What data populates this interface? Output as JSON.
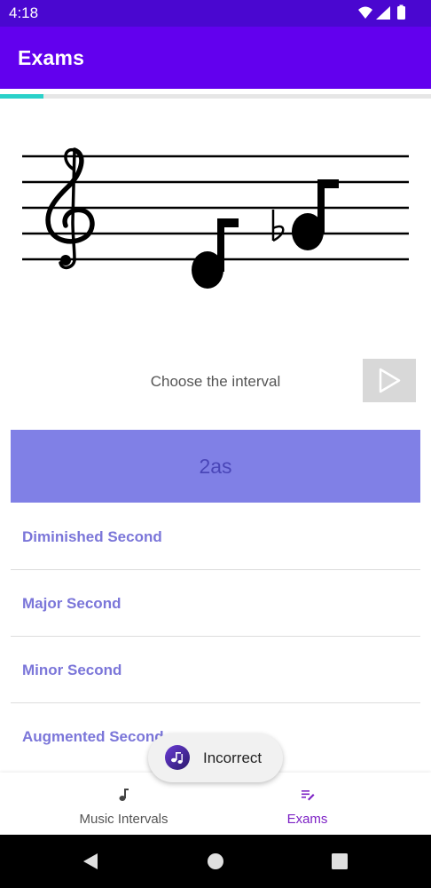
{
  "status_bar": {
    "time": "4:18"
  },
  "app_bar": {
    "title": "Exams"
  },
  "progress": {
    "fraction": 0.1
  },
  "staff": {
    "clef": "treble-clef",
    "accidental": "flat"
  },
  "prompt": {
    "text": "Choose the interval"
  },
  "answer": {
    "text": "2as"
  },
  "options": [
    {
      "label": "Diminished Second"
    },
    {
      "label": "Major Second"
    },
    {
      "label": "Minor Second"
    },
    {
      "label": "Augmented Second"
    }
  ],
  "bottom_nav": {
    "items": [
      {
        "label": "Music Intervals",
        "icon": "music-note-icon"
      },
      {
        "label": "Exams",
        "icon": "exams-list-icon"
      }
    ]
  },
  "toast": {
    "text": "Incorrect",
    "icon": "app-logo-icon"
  },
  "colors": {
    "status_bar": "#4a07d0",
    "app_bar": "#6200ee",
    "progress": "#2ad1c9",
    "answer_bg": "#8080e6",
    "option_text": "#7b76d9",
    "nav_active": "#7d22c5"
  }
}
